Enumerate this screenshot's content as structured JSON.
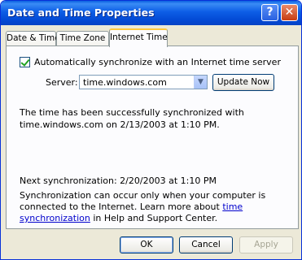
{
  "window": {
    "title": "Date and Time Properties",
    "help_label": "?",
    "close_label": "✕"
  },
  "tabs": [
    {
      "label": "Date & Time",
      "active": false
    },
    {
      "label": "Time Zone",
      "active": false
    },
    {
      "label": "Internet Time",
      "active": true
    }
  ],
  "internet_time": {
    "auto_sync_label": "Automatically synchronize with an Internet time server",
    "auto_sync_checked": true,
    "server_label": "Server:",
    "server_value": "time.windows.com",
    "update_now_label": "Update Now",
    "status": "The time has been successfully synchronized with time.windows.com on 2/13/2003 at 1:10 PM.",
    "next_sync": "Next synchronization: 2/20/2003 at 1:10 PM",
    "info_before": "Synchronization can occur only when your computer is connected to the Internet.  Learn more about ",
    "info_link": "time synchronization",
    "info_after": " in Help and Support Center."
  },
  "buttons": {
    "ok": "OK",
    "cancel": "Cancel",
    "apply": "Apply"
  },
  "colors": {
    "titlebar": "#0349d4",
    "dialog_bg": "#ece9d8",
    "link": "#0000cc"
  }
}
